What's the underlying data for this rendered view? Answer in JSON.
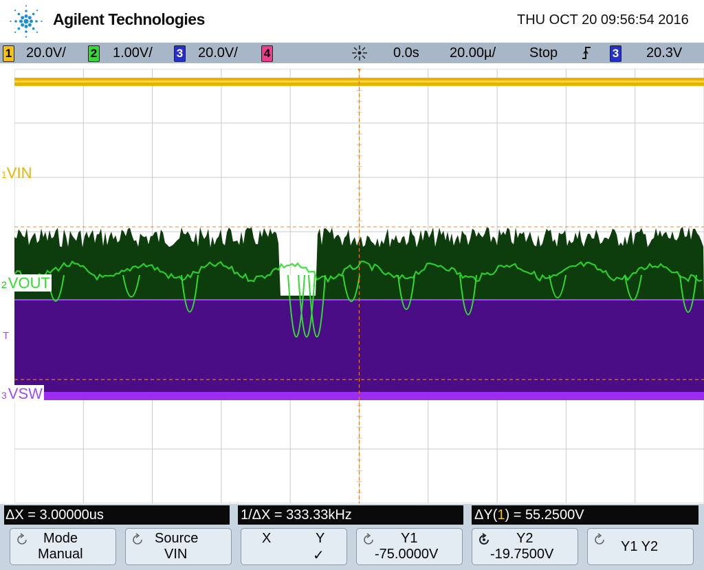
{
  "header": {
    "brand": "Agilent Technologies",
    "datetime": "THU OCT 20 09:56:54 2016"
  },
  "status": {
    "channels": [
      {
        "num": "1",
        "scale": "20.0V/",
        "color": "#f4c20d",
        "text_color": "#000000"
      },
      {
        "num": "2",
        "scale": "1.00V/",
        "color": "#2fdc2f",
        "text_color": "#000000"
      },
      {
        "num": "3",
        "scale": "20.0V/",
        "color": "#2430c8",
        "text_color": "#ffffff"
      },
      {
        "num": "4",
        "scale": "",
        "color": "#f03c8c",
        "text_color": "#000000"
      }
    ],
    "delay": "0.0s",
    "timebase": "20.00µ/",
    "run_state": "Stop",
    "trigger_source": "3",
    "trigger_level": "20.3V"
  },
  "traces": {
    "vin_label": "VIN",
    "vout_label": "VOUT",
    "vsw_label": "VSW",
    "trigger_label": "T",
    "ch1_marker": "1",
    "ch2_marker": "2",
    "ch3_marker": "3",
    "colors": {
      "ch1": "#f4c20d",
      "ch2": "#2fdc2f",
      "ch3": "#a64dff",
      "cursor": "#e87a1e"
    }
  },
  "measurements": {
    "dx": "ΔX = 3.00000us",
    "inv_dx": "1/ΔX = 333.33kHz",
    "dy_prefix": "ΔY(",
    "dy_channel": "1",
    "dy_suffix": ") = 55.2500V"
  },
  "softkeys": [
    {
      "line1": "Mode",
      "line2": "Manual"
    },
    {
      "line1": "Source",
      "line2": "VIN"
    },
    {
      "line1": "X",
      "line1b": "Y",
      "line2": "✓"
    },
    {
      "line1": "Y1",
      "line2": "-75.0000V"
    },
    {
      "line1": "Y2",
      "line2": "-19.7500V"
    },
    {
      "line1": "Y1 Y2",
      "line2": ""
    }
  ]
}
